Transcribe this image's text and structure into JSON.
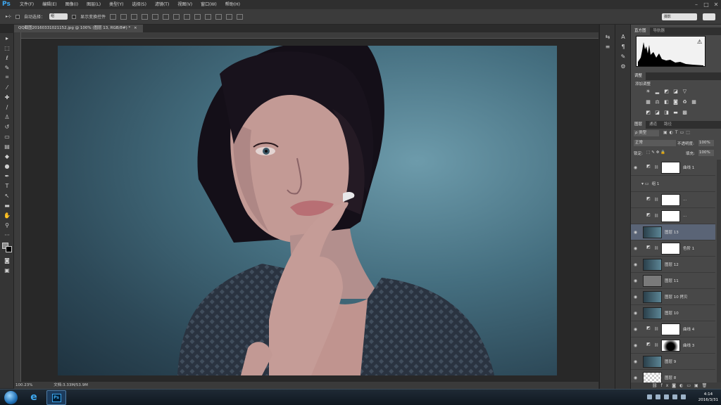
{
  "app": {
    "logo": "Ps"
  },
  "menu": [
    "文件(F)",
    "编辑(E)",
    "图像(I)",
    "图层(L)",
    "类型(Y)",
    "选择(S)",
    "滤镜(T)",
    "视图(V)",
    "窗口(W)",
    "帮助(H)"
  ],
  "window_controls": {
    "min": "–",
    "max": "□",
    "close": "✕"
  },
  "options": {
    "auto_select_label": "自动选择：",
    "auto_select_value": "组",
    "show_transform_label": "显示变换控件",
    "workspace": "摄影"
  },
  "document": {
    "tab_title": "QQ截图20160331021152.jpg @ 100% (图层 13, RGB/8#) *",
    "tab_close": "×",
    "zoom": "100.23%",
    "doc_info": "文档:3.33M/53.9M"
  },
  "panels": {
    "histogram_tabs": [
      "直方图",
      "导航器"
    ],
    "adjust_tab": "调整",
    "adjust_title": "添加调整",
    "layers_tabs": [
      "图层",
      "通道",
      "路径"
    ],
    "filter_label": "ρ 类型",
    "blend_mode": "正常",
    "opacity_label": "不透明度:",
    "opacity_value": "100%",
    "lock_label": "锁定:",
    "fill_label": "填充:",
    "fill_value": "100%"
  },
  "layers": [
    {
      "name": "曲线 1",
      "kind": "adj",
      "thumb": "white",
      "visible": true,
      "selected": false
    },
    {
      "name": "组 1",
      "kind": "group",
      "thumb": "",
      "visible": false,
      "selected": false
    },
    {
      "name": "...",
      "kind": "adj",
      "thumb": "white",
      "visible": false,
      "selected": false
    },
    {
      "name": "...",
      "kind": "adj",
      "thumb": "white",
      "visible": false,
      "selected": false
    },
    {
      "name": "图层 13",
      "kind": "pixel",
      "thumb": "photo",
      "visible": true,
      "selected": true
    },
    {
      "name": "色阶 1",
      "kind": "adj",
      "thumb": "white",
      "visible": true,
      "selected": false
    },
    {
      "name": "图层 12",
      "kind": "pixel",
      "thumb": "photo",
      "visible": true,
      "selected": false
    },
    {
      "name": "图层 11",
      "kind": "pixel",
      "thumb": "gray",
      "visible": true,
      "selected": false
    },
    {
      "name": "图层 10 拷贝",
      "kind": "pixel",
      "thumb": "photo",
      "visible": true,
      "selected": false
    },
    {
      "name": "图层 10",
      "kind": "pixel",
      "thumb": "photo",
      "visible": true,
      "selected": false
    },
    {
      "name": "曲线 4",
      "kind": "adj",
      "thumb": "white",
      "visible": true,
      "selected": false
    },
    {
      "name": "曲线 3",
      "kind": "adj",
      "thumb": "mask",
      "visible": true,
      "selected": false
    },
    {
      "name": "图层 9",
      "kind": "pixel",
      "thumb": "photo",
      "visible": true,
      "selected": false
    },
    {
      "name": "图层 8",
      "kind": "pixel",
      "thumb": "trans",
      "visible": true,
      "selected": false
    }
  ],
  "taskbar": {
    "ie_icon": "e",
    "ps_icon": "Ps",
    "time": "4:14",
    "date": "2016/3/31"
  }
}
